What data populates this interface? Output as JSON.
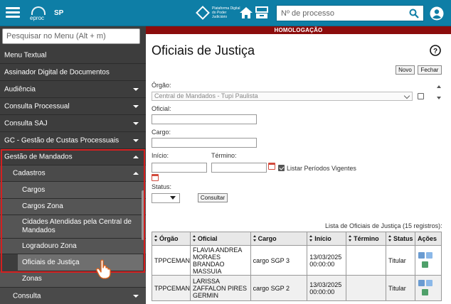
{
  "header": {
    "logo_text": "eproc",
    "state": "SP",
    "platform_text": "Plataforma Digital do Poder Judiciário",
    "search_placeholder": "Nº de processo"
  },
  "banner": "HOMOLOGAÇÃO",
  "sidebar": {
    "search_placeholder": "Pesquisar no Menu (Alt + m)",
    "items": [
      {
        "label": "Menu Textual",
        "expandable": false
      },
      {
        "label": "Assinador Digital de Documentos",
        "expandable": false
      },
      {
        "label": "Audiência",
        "expandable": true
      },
      {
        "label": "Consulta Processual",
        "expandable": true
      },
      {
        "label": "Consulta SAJ",
        "expandable": true
      },
      {
        "label": "GC - Gestão de Custas Processuais",
        "expandable": true
      },
      {
        "label": "Gestão de Mandados",
        "expandable": true
      }
    ],
    "cadastros_label": "Cadastros",
    "subitems": [
      "Cargos",
      "Cargos Zona",
      "Cidades Atendidas pela Central de Mandados",
      "Logradouro Zona",
      "Oficiais de Justiça",
      "Zonas"
    ],
    "active_subitem": "Oficiais de Justiça",
    "consulta_label": "Consulta"
  },
  "main": {
    "title": "Oficiais de Justiça",
    "novo_label": "Novo",
    "fechar_label": "Fechar",
    "orgao_label": "Órgão:",
    "orgao_value": "Central de Mandados - Tupi Paulista",
    "oficial_label": "Oficial:",
    "cargo_label": "Cargo:",
    "inicio_label": "Início:",
    "termino_label": "Término:",
    "listar_label": "Listar Períodos Vigentes",
    "status_label": "Status:",
    "consultar_label": "Consultar"
  },
  "table": {
    "caption": "Lista de Oficiais de Justiça (15 registros):",
    "headers": [
      "Órgão",
      "Oficial",
      "Cargo",
      "Início",
      "Término",
      "Status",
      "Ações"
    ],
    "rows": [
      {
        "orgao": "TPPCEMAN",
        "oficial": "FLAVIA ANDREA MORAES BRANDAO MASSUIA",
        "cargo": "cargo SGP 3",
        "inicio": "13/03/2025 00:00:00",
        "termino": "",
        "status": "Titular"
      },
      {
        "orgao": "TPPCEMAN",
        "oficial": "LARISSA ZAFFALON PIRES GERMIN",
        "cargo": "cargo SGP 2",
        "inicio": "13/03/2025 00:00:00",
        "termino": "",
        "status": "Titular"
      }
    ]
  },
  "colors": {
    "topbar": "#0e7ea6",
    "banner": "#8b0c0c",
    "sidebar": "#3d3d3d",
    "highlight": "#d42020"
  }
}
